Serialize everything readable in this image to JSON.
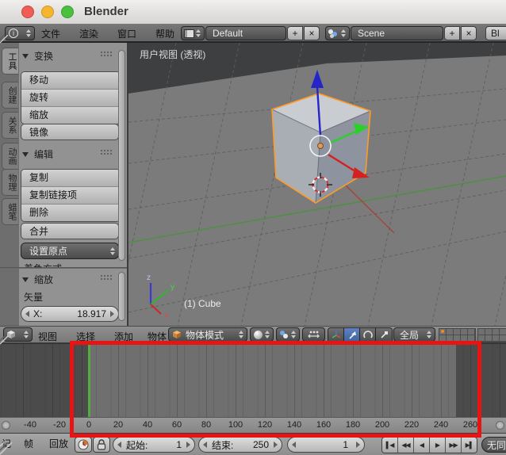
{
  "titlebar": {
    "title": "Blender"
  },
  "infobar": {
    "menus": [
      "文件",
      "渲染",
      "窗口",
      "帮助"
    ],
    "layout_value": "Default",
    "scene_value": "Scene",
    "engine_partial": "Bl",
    "add_glyph": "+",
    "close_glyph": "×"
  },
  "toolshelf": {
    "tabs": [
      "工具",
      "创建",
      "关系",
      "动画",
      "物理",
      "蜡笔"
    ],
    "transform_panel": {
      "title": "变换",
      "move": "移动",
      "rotate": "旋转",
      "scale": "缩放",
      "mirror": "镜像"
    },
    "edit_panel": {
      "title": "编辑",
      "duplicate": "复制",
      "duplicate_linked": "复制链接项",
      "delete": "删除",
      "join": "合并",
      "set_origin": "设置原点",
      "shading_clipped": "着色方式"
    },
    "redo_panel": {
      "title": "缩放",
      "vector_label": "矢量",
      "x_label": "X:",
      "x_value": "18.917"
    }
  },
  "viewport": {
    "view_label": "用户视图 (透视)",
    "object_info": "(1) Cube",
    "axis_labels": {
      "x": "x",
      "y": "y",
      "z": "z"
    }
  },
  "header3d": {
    "menus": [
      "视图",
      "选择",
      "添加",
      "物体"
    ],
    "mode_value": "物体模式",
    "orientation_value": "全局"
  },
  "timeline": {
    "ticks": [
      "-40",
      "-20",
      "0",
      "20",
      "40",
      "60",
      "80",
      "100",
      "120",
      "140",
      "160",
      "180",
      "200",
      "220",
      "240",
      "260"
    ],
    "current_frame": 1
  },
  "timeline_bar": {
    "marker_menu_partial": "记",
    "frame_menu": "帧",
    "playback_menu": "回放",
    "start_label": "起始:",
    "start_value": "1",
    "end_label": "结束:",
    "end_value": "250",
    "frame_value": "1",
    "sync_partial": "无同",
    "playback_buttons": [
      {
        "name": "jump-to-start",
        "glyph": "▌◀"
      },
      {
        "name": "prev-keyframe",
        "glyph": "◀◀"
      },
      {
        "name": "play-reverse",
        "glyph": "◀"
      },
      {
        "name": "play",
        "glyph": "▶"
      },
      {
        "name": "next-keyframe",
        "glyph": "▶▶"
      },
      {
        "name": "jump-to-end",
        "glyph": "▶▌"
      }
    ]
  },
  "colors": {
    "selection_orange": "#ff9d2c",
    "current_frame_green": "#55ad42",
    "annotation_red": "#e81414"
  }
}
